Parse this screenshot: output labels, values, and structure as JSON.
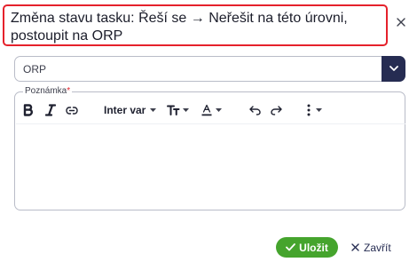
{
  "dialog": {
    "title": "Změna stavu tasku: Řeší se → Neřešit na této úrovni, postoupit na ORP",
    "close_icon": "close-icon"
  },
  "level_select": {
    "value": "ORP",
    "icon": "chevron-down-icon"
  },
  "editor": {
    "label": "Poznámka",
    "required_mark": "*",
    "toolbar": {
      "bold_icon": "bold-icon",
      "italic_icon": "italic-icon",
      "link_icon": "link-icon",
      "font_family": "Inter var",
      "font_size_icon": "text-size-icon",
      "text_color_icon": "text-color-icon",
      "undo_icon": "undo-icon",
      "redo_icon": "redo-icon",
      "more_icon": "more-vertical-icon"
    },
    "content": ""
  },
  "actions": {
    "save_label": "Uložit",
    "cancel_label": "Zavřít"
  },
  "colors": {
    "highlight_border": "#e5212b",
    "select_accent": "#262c52",
    "save_button": "#45a42d"
  }
}
